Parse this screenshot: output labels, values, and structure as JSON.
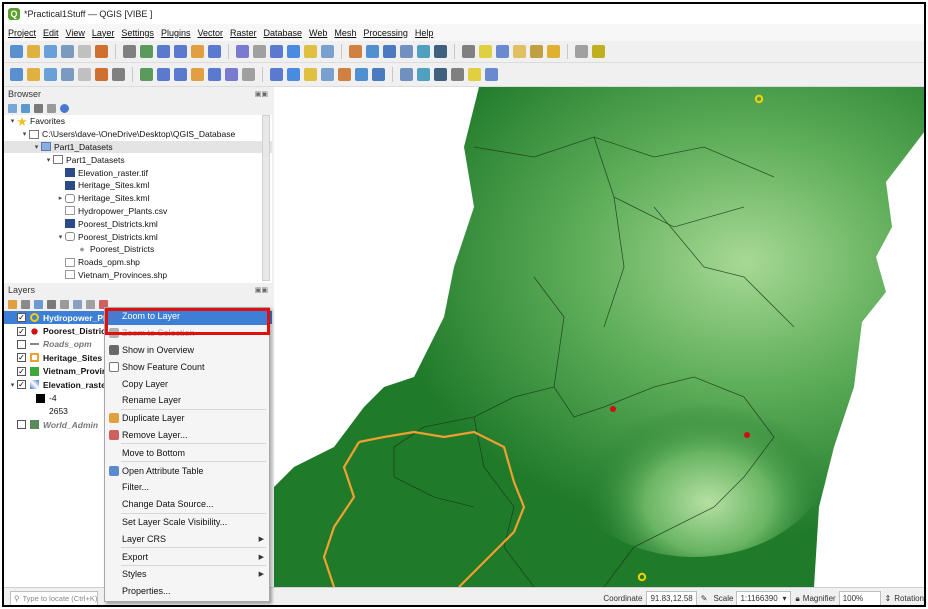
{
  "window": {
    "title": "*Practical1Stuff — QGIS [VIBE ]",
    "logo_letter": "Q"
  },
  "menubar": [
    "Project",
    "Edit",
    "View",
    "Layer",
    "Settings",
    "Plugins",
    "Vector",
    "Raster",
    "Database",
    "Web",
    "Mesh",
    "Processing",
    "Help"
  ],
  "toolbar1_icons": [
    "new-project-icon",
    "open-project-icon",
    "save-project-icon",
    "save-as-icon",
    "print-layout-icon",
    "style-manager-icon",
    "pan-icon",
    "pan-to-selection-icon",
    "zoom-in-icon",
    "zoom-out-icon",
    "zoom-full-icon",
    "zoom-to-selection-icon",
    "zoom-to-layer-icon",
    "zoom-native-icon",
    "zoom-last-icon",
    "zoom-next-icon",
    "new-map-view-icon",
    "new-3d-view-icon",
    "temporal-icon",
    "refresh-icon",
    "identify-icon",
    "attribute-table-icon",
    "settings-icon",
    "sum-icon",
    "measure-icon",
    "annotation-icon",
    "select-icon",
    "text-icon",
    "deselect-icon",
    "layer-select-icon",
    "filter-icon",
    "label-icon"
  ],
  "toolbar2_icons": [
    "digitize-icon",
    "edit-icon",
    "new-layer-icon",
    "pencil-icon",
    "save-edits-icon",
    "style-icon",
    "add-feature-icon",
    "vertex-icon",
    "add-line-icon",
    "node-icon",
    "delete-icon",
    "cut-icon",
    "copy-icon",
    "paste-icon",
    "undo-icon",
    "redo-icon",
    "label-pin-icon",
    "label-show-icon",
    "label-move-icon",
    "diagram-icon",
    "label-rotate-icon",
    "label-change-icon",
    "label-pin2-icon",
    "label-hide-icon",
    "plugin-icon",
    "python-icon",
    "help-icon"
  ],
  "browser": {
    "title": "Browser",
    "items": [
      {
        "label": "Favorites",
        "indent": 0,
        "arrow": "▾",
        "icon": "star-icon"
      },
      {
        "label": "C:\\Users\\dave-\\OneDrive\\Desktop\\QGIS_Database",
        "indent": 1,
        "arrow": "▾",
        "icon": "folder-icon"
      },
      {
        "label": "Part1_Datasets",
        "indent": 2,
        "arrow": "▾",
        "icon": "folder-blue-icon",
        "selected": true
      },
      {
        "label": "Part1_Datasets",
        "indent": 3,
        "arrow": "▾",
        "icon": "folder-icon"
      },
      {
        "label": "Elevation_raster.tif",
        "indent": 4,
        "arrow": "",
        "icon": "raster-icon"
      },
      {
        "label": "Heritage_Sites.kml",
        "indent": 4,
        "arrow": "",
        "icon": "raster-icon"
      },
      {
        "label": "Heritage_Sites.kml",
        "indent": 4,
        "arrow": "▸",
        "icon": "db-icon"
      },
      {
        "label": "Hydropower_Plants.csv",
        "indent": 4,
        "arrow": "",
        "icon": "table-icon"
      },
      {
        "label": "Poorest_Districts.kml",
        "indent": 4,
        "arrow": "",
        "icon": "raster-icon"
      },
      {
        "label": "Poorest_Districts.kml",
        "indent": 4,
        "arrow": "▾",
        "icon": "db-icon"
      },
      {
        "label": "Poorest_Districts",
        "indent": 5,
        "arrow": "",
        "icon": "points-icon"
      },
      {
        "label": "Roads_opm.shp",
        "indent": 4,
        "arrow": "",
        "icon": "line-layer-icon"
      },
      {
        "label": "Vietnam_Provinces.shp",
        "indent": 4,
        "arrow": "",
        "icon": "line-layer-icon"
      }
    ]
  },
  "layers": {
    "title": "Layers",
    "items": [
      {
        "label": "Hydropower_Plants",
        "checked": true,
        "bold": true,
        "italic": false,
        "swatch": "#f5d000",
        "shape": "circle",
        "selected": true,
        "arrow": ""
      },
      {
        "label": "Poorest_Districts",
        "checked": true,
        "bold": true,
        "italic": false,
        "swatch": "#d01010",
        "shape": "dot",
        "arrow": ""
      },
      {
        "label": "Roads_opm",
        "checked": false,
        "bold": true,
        "italic": true,
        "swatch": "#888888",
        "shape": "line",
        "arrow": ""
      },
      {
        "label": "Heritage_Sites",
        "checked": true,
        "bold": true,
        "italic": false,
        "swatch": "#f0a030",
        "shape": "square-outline",
        "arrow": ""
      },
      {
        "label": "Vietnam_Provinces",
        "checked": true,
        "bold": true,
        "italic": false,
        "swatch": "#3aa83a",
        "shape": "square",
        "arrow": ""
      },
      {
        "label": "Elevation_raster",
        "checked": true,
        "bold": true,
        "italic": false,
        "swatch": "#3a7acb",
        "shape": "raster",
        "arrow": "▾"
      },
      {
        "label": "-4",
        "checked": null,
        "bold": false,
        "italic": false,
        "swatch": "#000000",
        "shape": "square",
        "arrow": "",
        "legend": true
      },
      {
        "label": "2653",
        "checked": null,
        "bold": false,
        "italic": false,
        "swatch": "#ffffff",
        "shape": "none",
        "arrow": "",
        "legend": true
      },
      {
        "label": "World_Admin",
        "checked": false,
        "bold": true,
        "italic": true,
        "swatch": "#5a8a5a",
        "shape": "square",
        "arrow": ""
      }
    ]
  },
  "context_menu": {
    "items": [
      {
        "label": "Zoom to Layer",
        "highlighted": true,
        "disabled": false,
        "icon": "zoom-to-layer-icon",
        "submenu": false
      },
      {
        "label": "Zoom to Selection",
        "highlighted": false,
        "disabled": true,
        "icon": "zoom-selection-icon",
        "submenu": false
      },
      {
        "label": "Show in Overview",
        "highlighted": false,
        "disabled": false,
        "icon": "overview-icon",
        "submenu": false
      },
      {
        "label": "Show Feature Count",
        "highlighted": false,
        "disabled": false,
        "icon": "checkbox-icon",
        "submenu": false
      },
      {
        "label": "Copy Layer",
        "highlighted": false,
        "disabled": false,
        "icon": "",
        "submenu": false
      },
      {
        "label": "Rename Layer",
        "highlighted": false,
        "disabled": false,
        "icon": "",
        "submenu": false
      },
      {
        "sep": true
      },
      {
        "label": "Duplicate Layer",
        "highlighted": false,
        "disabled": false,
        "icon": "duplicate-icon",
        "submenu": false
      },
      {
        "label": "Remove Layer...",
        "highlighted": false,
        "disabled": false,
        "icon": "remove-layer-icon",
        "submenu": false
      },
      {
        "sep": true
      },
      {
        "label": "Move to Bottom",
        "highlighted": false,
        "disabled": false,
        "icon": "",
        "submenu": false
      },
      {
        "sep": true
      },
      {
        "label": "Open Attribute Table",
        "highlighted": false,
        "disabled": false,
        "icon": "table-icon",
        "submenu": false
      },
      {
        "label": "Filter...",
        "highlighted": false,
        "disabled": false,
        "icon": "",
        "submenu": false
      },
      {
        "label": "Change Data Source...",
        "highlighted": false,
        "disabled": false,
        "icon": "",
        "submenu": false
      },
      {
        "sep": true
      },
      {
        "label": "Set Layer Scale Visibility...",
        "highlighted": false,
        "disabled": false,
        "icon": "",
        "submenu": false
      },
      {
        "label": "Layer CRS",
        "highlighted": false,
        "disabled": false,
        "icon": "",
        "submenu": true
      },
      {
        "sep": true
      },
      {
        "label": "Export",
        "highlighted": false,
        "disabled": false,
        "icon": "",
        "submenu": true
      },
      {
        "sep": true
      },
      {
        "label": "Styles",
        "highlighted": false,
        "disabled": false,
        "icon": "",
        "submenu": true
      },
      {
        "label": "Properties...",
        "highlighted": false,
        "disabled": false,
        "icon": "",
        "submenu": false
      }
    ]
  },
  "statusbar": {
    "locate_placeholder": "Type to locate (Ctrl+K)",
    "coordinate_label": "Coordinate",
    "coordinate_value": "91.83,12.58",
    "scale_label": "Scale",
    "scale_value": "1:1166390",
    "magnifier_label": "Magnifier",
    "magnifier_value": "100%",
    "rotation_label": "Rotation"
  },
  "colors": {
    "map_dark": "#1f7a2a",
    "map_mid": "#3f9a44",
    "map_light": "#9fd48e",
    "heritage_outline": "#f0a030",
    "highlight": "#3d7fd6",
    "annotation_box": "#e01010"
  }
}
